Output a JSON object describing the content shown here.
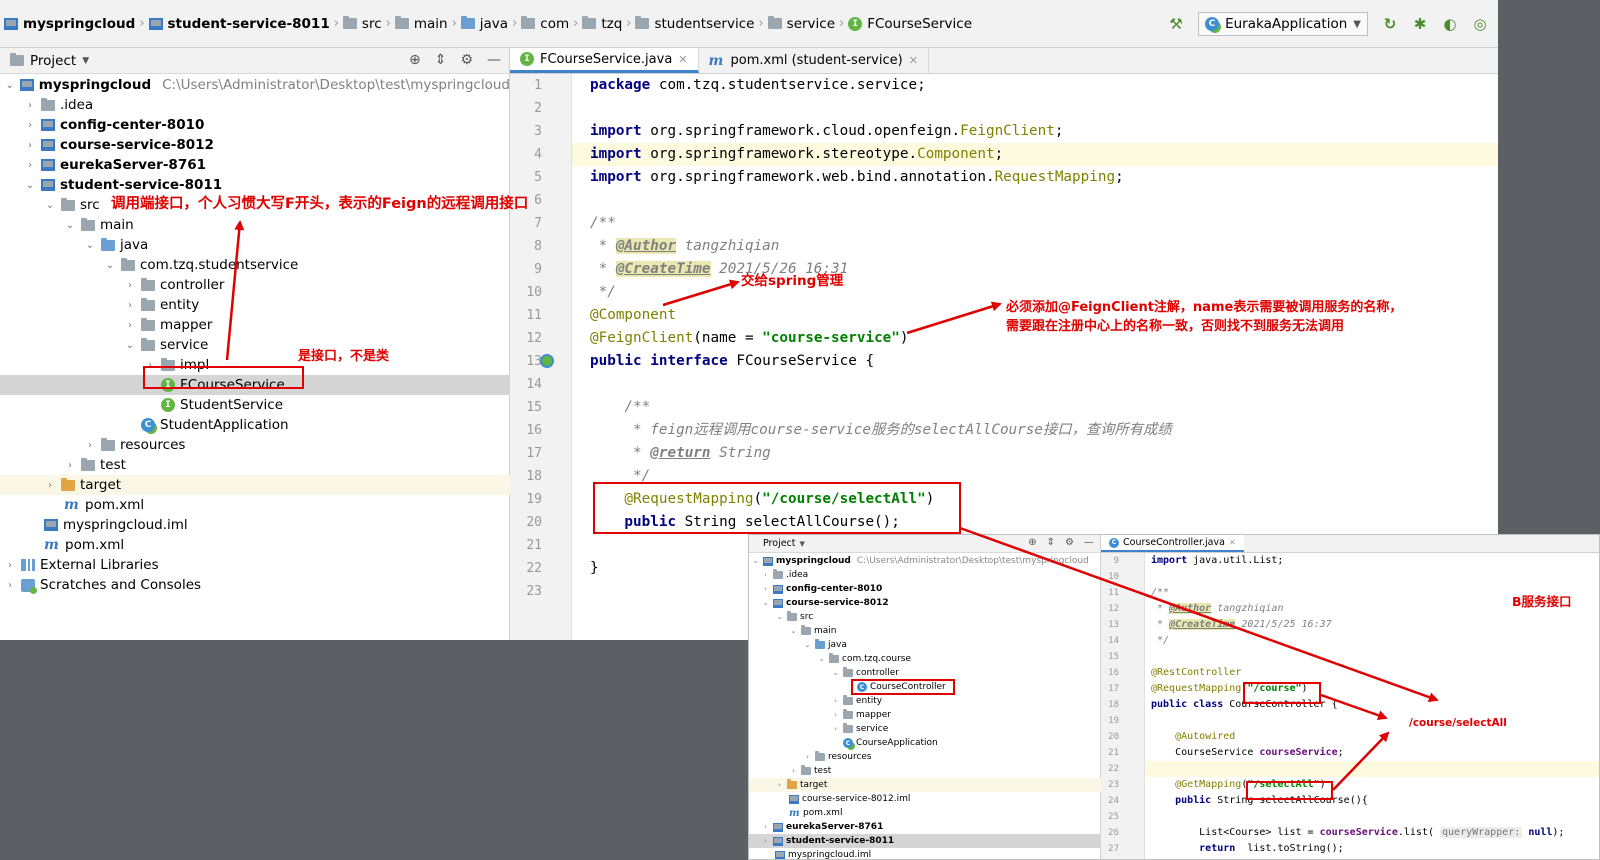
{
  "breadcrumbs": [
    "myspringcloud",
    "student-service-8011",
    "src",
    "main",
    "java",
    "com",
    "tzq",
    "studentservice",
    "service",
    "FCourseService"
  ],
  "run_config": "EurakaApplication",
  "project_panel": {
    "title": "Project",
    "tree": [
      {
        "label": "myspringcloud",
        "path": "C:\\Users\\Administrator\\Desktop\\test\\myspringcloud"
      },
      {
        "label": ".idea"
      },
      {
        "label": "config-center-8010"
      },
      {
        "label": "course-service-8012"
      },
      {
        "label": "eurekaServer-8761"
      },
      {
        "label": "student-service-8011"
      },
      {
        "label": "src"
      },
      {
        "label": "main"
      },
      {
        "label": "java"
      },
      {
        "label": "com.tzq.studentservice"
      },
      {
        "label": "controller"
      },
      {
        "label": "entity"
      },
      {
        "label": "mapper"
      },
      {
        "label": "service"
      },
      {
        "label": "impl"
      },
      {
        "label": "FCourseService"
      },
      {
        "label": "StudentService"
      },
      {
        "label": "StudentApplication"
      },
      {
        "label": "resources"
      },
      {
        "label": "test"
      },
      {
        "label": "target"
      },
      {
        "label": "pom.xml"
      },
      {
        "label": "myspringcloud.iml"
      },
      {
        "label": "pom.xml"
      },
      {
        "label": "External Libraries"
      },
      {
        "label": "Scratches and Consoles"
      }
    ]
  },
  "editor": {
    "tabs": [
      "FCourseService.java",
      "pom.xml (student-service)"
    ],
    "line_numbers": [
      "1",
      "2",
      "3",
      "4",
      "5",
      "6",
      "7",
      "8",
      "9",
      "10",
      "11",
      "12",
      "13",
      "14",
      "15",
      "16",
      "17",
      "18",
      "19",
      "20",
      "21",
      "22",
      "23"
    ],
    "code": {
      "l1_kw": "package",
      "l1_rest": " com.tzq.studentservice.service;",
      "l3_kw": "import",
      "l3_rest": " org.springframework.cloud.openfeign.",
      "l3_cls": "FeignClient",
      "l3_end": ";",
      "l4_kw": "import",
      "l4_rest": " org.springframework.stereotype.",
      "l4_cls": "Component",
      "l4_end": ";",
      "l5_kw": "import",
      "l5_rest": " org.springframework.web.bind.annotation.",
      "l5_cls": "RequestMapping",
      "l5_end": ";",
      "l7": "/**",
      "l8_pre": " * ",
      "l8_tag": "@Author",
      "l8_val": " tangzhiqian",
      "l9_pre": " * ",
      "l9_tag": "@CreateTime",
      "l9_val": " 2021/5/26 16:31",
      "l10": " */",
      "l11": "@Component",
      "l12_ann": "@FeignClient",
      "l12_a": "(name = ",
      "l12_str": "\"course-service\"",
      "l12_b": ")",
      "l13_kw": "public interface",
      "l13_rest": " FCourseService {",
      "l15": "    /**",
      "l16": "     * feign远程调用course-service服务的selectAllCourse接口，查询所有成绩",
      "l17_pre": "     * ",
      "l17_tag": "@return",
      "l17_val": " String",
      "l18": "     */",
      "l19_ann": "    @RequestMapping",
      "l19_a": "(",
      "l19_str": "\"/course/selectAll\"",
      "l19_b": ")",
      "l20_kw": "    public",
      "l20_rest": " String selectAllCourse();",
      "l22": "}"
    }
  },
  "annotations": {
    "a1": "调用端接口，个人习惯大写F开头，表示的Feign的远程调用接口",
    "a2": "是接口，不是类",
    "a3": "交给spring管理",
    "a4_line1": "必须添加@FeignClient注解，name表示需要被调用服务的名称，",
    "a4_line2": "需要跟在注册中心上的名称一致，否则找不到服务无法调用",
    "a5": "B服务接口",
    "a6": "/course/selectAll"
  },
  "inset": {
    "project_title": "Project",
    "tree": [
      {
        "label": "myspringcloud",
        "path": "C:\\Users\\Administrator\\Desktop\\test\\myspringcloud"
      },
      {
        "label": ".idea"
      },
      {
        "label": "config-center-8010"
      },
      {
        "label": "course-service-8012"
      },
      {
        "label": "src"
      },
      {
        "label": "main"
      },
      {
        "label": "java"
      },
      {
        "label": "com.tzq.course"
      },
      {
        "label": "controller"
      },
      {
        "label": "CourseController"
      },
      {
        "label": "entity"
      },
      {
        "label": "mapper"
      },
      {
        "label": "service"
      },
      {
        "label": "CourseApplication"
      },
      {
        "label": "resources"
      },
      {
        "label": "test"
      },
      {
        "label": "target"
      },
      {
        "label": "course-service-8012.iml"
      },
      {
        "label": "pom.xml"
      },
      {
        "label": "eurekaServer-8761"
      },
      {
        "label": "student-service-8011"
      },
      {
        "label": "myspringcloud.iml"
      }
    ],
    "editor_tab": "CourseController.java",
    "line_numbers": [
      "9",
      "10",
      "11",
      "12",
      "13",
      "14",
      "15",
      "16",
      "17",
      "18",
      "19",
      "20",
      "21",
      "22",
      "23",
      "24",
      "25",
      "26",
      "27"
    ],
    "code": {
      "l9_kw": "import",
      "l9_rest": " java.util.List;",
      "l11": "/**",
      "l12_pre": " * ",
      "l12_tag": "@Author",
      "l12_val": " tangzhiqian",
      "l13_pre": " * ",
      "l13_tag": "@CreateTime",
      "l13_val": " 2021/5/25 16:37",
      "l14": " */",
      "l16": "@RestController",
      "l17_ann": "@RequestMapping",
      "l17_a": "(",
      "l17_str": "\"/course\"",
      "l17_b": ")",
      "l18_kw": "public class",
      "l18_rest": " CourseController {",
      "l20": "    @Autowired",
      "l21_a": "    CourseService ",
      "l21_id": "courseService",
      "l21_b": ";",
      "l23_ann": "    @GetMapping",
      "l23_a": "(",
      "l23_str": "\"/selectAll\"",
      "l23_b": ")",
      "l24_kw": "    public",
      "l24_rest": " String selectAllCourse(){",
      "l26_a": "        List<Course> list = ",
      "l26_id": "courseService",
      "l26_b": ".list( ",
      "l26_hint": "queryWrapper:",
      "l26_kw": " null",
      "l26_c": ");",
      "l27_kw": "        return",
      "l27_rest": "  list.toString();"
    }
  },
  "colors": {
    "annotation_red": "#e00000",
    "selection": "#d5d5d5",
    "keyword": "#000080",
    "string": "#008000",
    "annotation": "#808000"
  }
}
